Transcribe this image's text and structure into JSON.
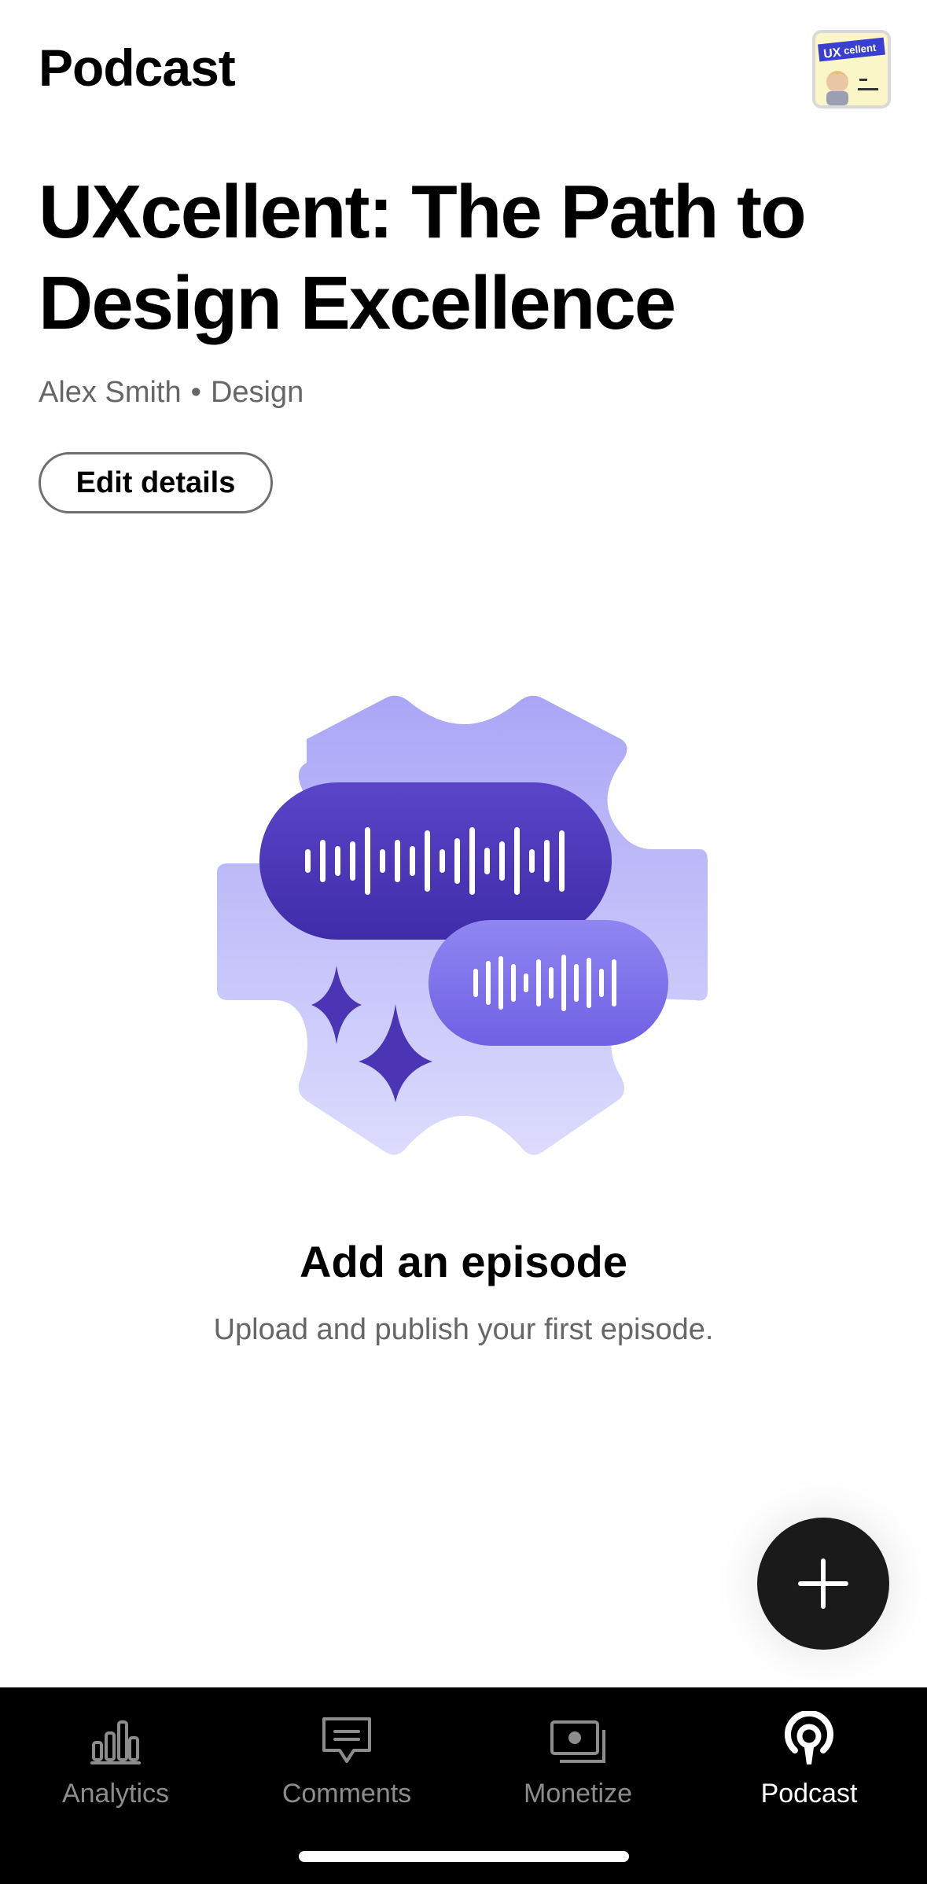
{
  "header": {
    "title": "Podcast",
    "cover_icon": "podcast-cover-thumbnail"
  },
  "show": {
    "title": "UXcellent: The Path to Design Excellence",
    "author": "Alex Smith",
    "separator": "•",
    "category": "Design",
    "edit_label": "Edit details"
  },
  "empty_state": {
    "illustration_icon": "audio-waveform-illustration",
    "title": "Add an episode",
    "subtitle": "Upload and publish your first episode."
  },
  "fab": {
    "icon": "plus-icon"
  },
  "tabs": [
    {
      "label": "Analytics",
      "icon": "bar-chart-icon",
      "active": false
    },
    {
      "label": "Comments",
      "icon": "comment-icon",
      "active": false
    },
    {
      "label": "Monetize",
      "icon": "money-icon",
      "active": false
    },
    {
      "label": "Podcast",
      "icon": "podcast-icon",
      "active": true
    }
  ],
  "colors": {
    "accent_dark": "#4b35b5",
    "accent_light": "#b3b0f7",
    "tab_active": "#ffffff",
    "tab_inactive": "#8c8c8c"
  }
}
